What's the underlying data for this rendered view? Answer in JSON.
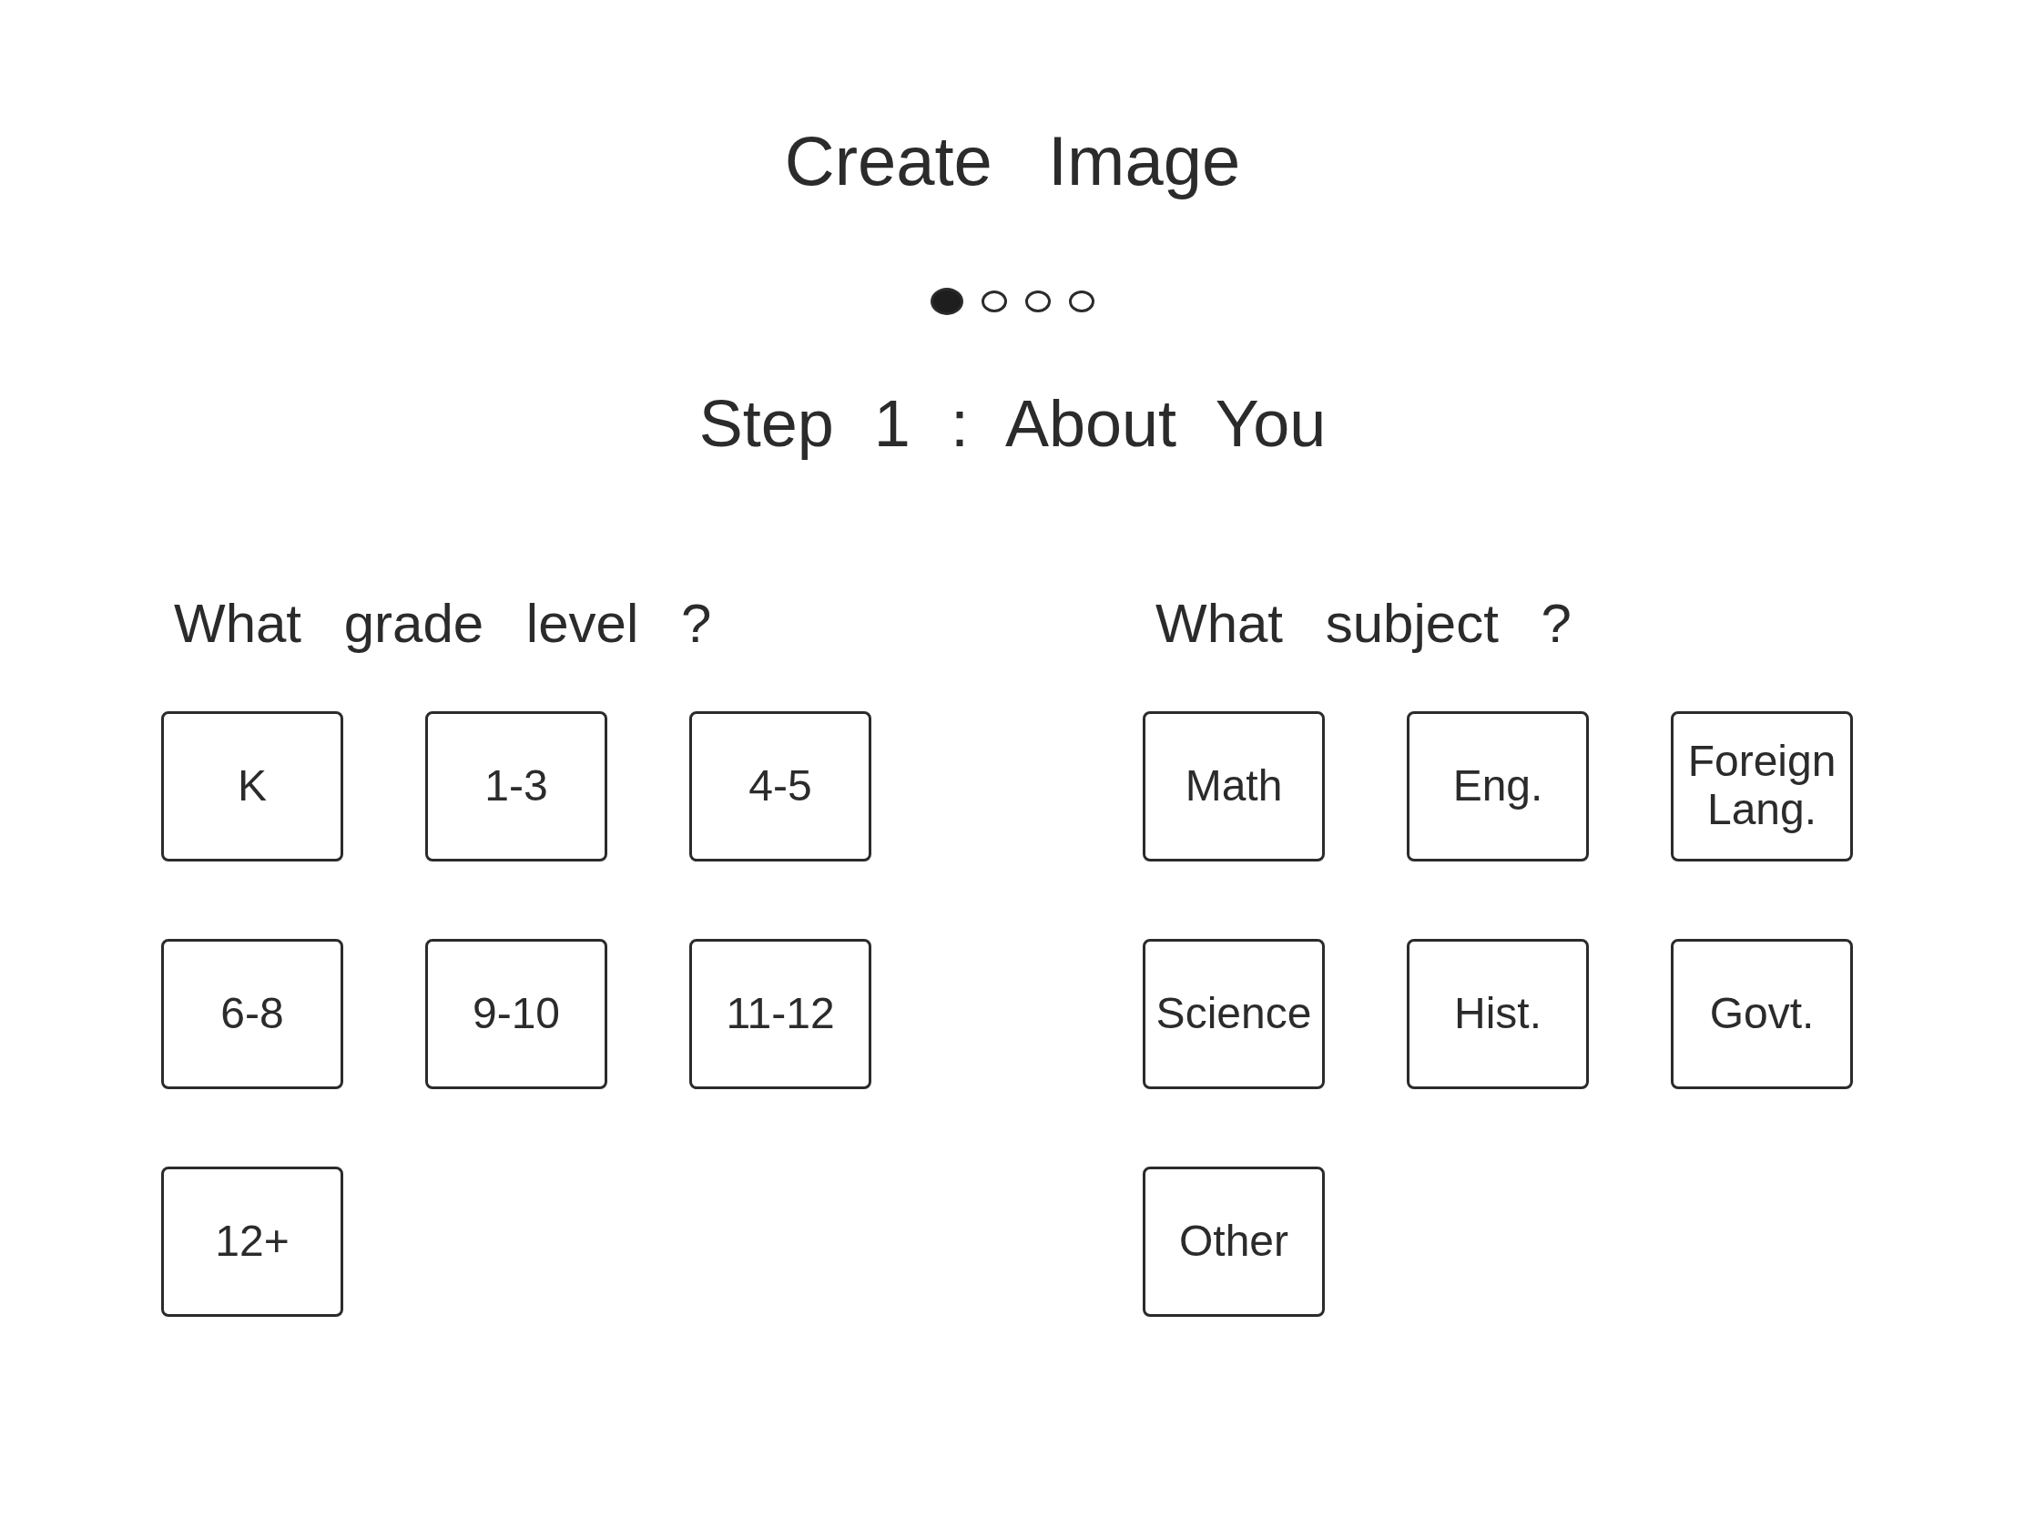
{
  "title": "Create Image",
  "steps": [
    {
      "selected": true
    },
    {
      "selected": false
    },
    {
      "selected": false
    },
    {
      "selected": false
    }
  ],
  "step_title": "Step 1 : About You",
  "questions": [
    {
      "heading": "What grade level ?",
      "options": [
        {
          "label": "K",
          "selected": false
        },
        {
          "label": "1-3",
          "selected": false
        },
        {
          "label": "4-5",
          "selected": false
        },
        {
          "label": "6-8",
          "selected": false
        },
        {
          "label": "9-10",
          "selected": false
        },
        {
          "label": "11-12",
          "selected": false
        },
        {
          "label": "12+",
          "selected": false
        }
      ]
    },
    {
      "heading": "What subject ?",
      "options": [
        {
          "label": "Math",
          "selected": false
        },
        {
          "label": "Eng.",
          "selected": false
        },
        {
          "label": "Foreign Lang.",
          "selected": false
        },
        {
          "label": "Science",
          "selected": false
        },
        {
          "label": "Hist.",
          "selected": false
        },
        {
          "label": "Govt.",
          "selected": false
        },
        {
          "label": "Other",
          "selected": false
        }
      ]
    }
  ]
}
